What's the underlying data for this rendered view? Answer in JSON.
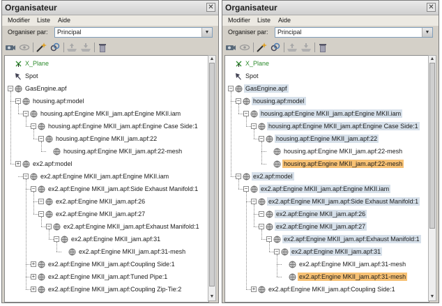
{
  "window": {
    "title": "Organisateur",
    "close_glyph": "✕"
  },
  "menu": [
    "Modifier",
    "Liste",
    "Aide"
  ],
  "organiser": {
    "label": "Organiser par:",
    "value": "Principal"
  },
  "toolbar_icons": [
    "camera-icon",
    "eye-icon",
    "wand-icon",
    "link-icon",
    "tray-in-icon",
    "tray-out-icon",
    "trash-icon"
  ],
  "colors": {
    "row_highlight": "#d6e0ea",
    "selection": "#f7c174",
    "xplane_text": "#2e8b2e"
  },
  "panels": [
    {
      "id": "left",
      "scroll_position": 0.0,
      "scroll_visible_fraction": 0.97,
      "rows": [
        {
          "label": "X_Plane",
          "icon": "xplane-icon",
          "level": 0,
          "exp": "none",
          "style": "green"
        },
        {
          "label": "Spot",
          "icon": "spot-icon",
          "level": 0,
          "exp": "none",
          "style": ""
        },
        {
          "label": "GasEngine.apf",
          "icon": "globe-icon",
          "level": 0,
          "exp": "minus",
          "style": ""
        },
        {
          "label": "housing.apf:model",
          "icon": "globe-icon",
          "level": 1,
          "exp": "minus",
          "style": ""
        },
        {
          "label": "housing.apf:Engine MKII_jam.apf:Engine MKII.iam",
          "icon": "globe-icon",
          "level": 2,
          "exp": "minus",
          "style": ""
        },
        {
          "label": "housing.apf:Engine MKII_jam.apf:Engine Case Side:1",
          "icon": "globe-icon",
          "level": 3,
          "exp": "minus",
          "style": ""
        },
        {
          "label": "housing.apf:Engine MKII_jam.apf:22",
          "icon": "globe-icon",
          "level": 4,
          "exp": "minus",
          "style": ""
        },
        {
          "label": "housing.apf:Engine MKII_jam.apf:22-mesh",
          "icon": "globe-icon",
          "level": 5,
          "exp": "none",
          "style": ""
        },
        {
          "label": "ex2.apf:model",
          "icon": "globe-icon",
          "level": 1,
          "exp": "plus",
          "style": ""
        },
        {
          "label": "ex2.apf:Engine MKII_jam.apf:Engine MKII.iam",
          "icon": "globe-icon",
          "level": 2,
          "exp": "minus",
          "style": ""
        },
        {
          "label": "ex2.apf:Engine MKII_jam.apf:Side Exhaust Manifold:1",
          "icon": "globe-icon",
          "level": 3,
          "exp": "minus",
          "style": ""
        },
        {
          "label": "ex2.apf:Engine MKII_jam.apf:26",
          "icon": "globe-icon",
          "level": 4,
          "exp": "minus",
          "style": ""
        },
        {
          "label": "ex2.apf:Engine MKII_jam.apf:27",
          "icon": "globe-icon",
          "level": 4,
          "exp": "minus",
          "style": ""
        },
        {
          "label": "ex2.apf:Engine MKII_jam.apf:Exhaust Manifold:1",
          "icon": "globe-icon",
          "level": 5,
          "exp": "minus",
          "style": ""
        },
        {
          "label": "ex2.apf:Engine MKII_jam.apf:31",
          "icon": "globe-icon",
          "level": 6,
          "exp": "minus",
          "style": ""
        },
        {
          "label": "ex2.apf:Engine MKII_jam.apf:31-mesh",
          "icon": "globe-icon",
          "level": 7,
          "exp": "none",
          "style": ""
        },
        {
          "label": "ex2.apf:Engine MKII_jam.apf:Coupling Side:1",
          "icon": "globe-icon",
          "level": 3,
          "exp": "plus",
          "style": ""
        },
        {
          "label": "ex2.apf:Engine MKII_jam.apf:Tuned Pipe:1",
          "icon": "globe-icon",
          "level": 3,
          "exp": "plus",
          "style": ""
        },
        {
          "label": "ex2.apf:Engine MKII_jam.apf:Coupling Zip-Tie:2",
          "icon": "globe-icon",
          "level": 3,
          "exp": "plus",
          "style": ""
        }
      ]
    },
    {
      "id": "right",
      "scroll_position": 0.0,
      "scroll_visible_fraction": 0.72,
      "rows": [
        {
          "label": "X_Plane",
          "icon": "xplane-icon",
          "level": 0,
          "exp": "none",
          "style": "green"
        },
        {
          "label": "Spot",
          "icon": "spot-icon",
          "level": 0,
          "exp": "none",
          "style": ""
        },
        {
          "label": "GasEngine.apf",
          "icon": "globe-icon",
          "level": 0,
          "exp": "minus",
          "style": "bg"
        },
        {
          "label": "housing.apf:model",
          "icon": "globe-icon",
          "level": 1,
          "exp": "minus",
          "style": "bg"
        },
        {
          "label": "housing.apf:Engine MKII_jam.apf:Engine MKII.iam",
          "icon": "globe-icon",
          "level": 2,
          "exp": "minus",
          "style": "bg"
        },
        {
          "label": "housing.apf:Engine MKII_jam.apf:Engine Case Side:1",
          "icon": "globe-icon",
          "level": 3,
          "exp": "minus",
          "style": "bg"
        },
        {
          "label": "housing.apf:Engine MKII_jam.apf:22",
          "icon": "globe-icon",
          "level": 4,
          "exp": "minus",
          "style": "bg"
        },
        {
          "label": "housing.apf:Engine MKII_jam.apf:22-mesh",
          "icon": "globe-icon",
          "level": 5,
          "exp": "none",
          "style": ""
        },
        {
          "label": "housing.apf:Engine MKII_jam.apf:22-mesh",
          "icon": "globe-icon",
          "level": 5,
          "exp": "none",
          "style": "sel"
        },
        {
          "label": "ex2.apf:model",
          "icon": "globe-icon",
          "level": 1,
          "exp": "minus",
          "style": "bg"
        },
        {
          "label": "ex2.apf:Engine MKII_jam.apf:Engine MKII.iam",
          "icon": "globe-icon",
          "level": 2,
          "exp": "minus",
          "style": "bg"
        },
        {
          "label": "ex2.apf:Engine MKII_jam.apf:Side Exhaust Manifold:1",
          "icon": "globe-icon",
          "level": 3,
          "exp": "minus",
          "style": "bg"
        },
        {
          "label": "ex2.apf:Engine MKII_jam.apf:26",
          "icon": "globe-icon",
          "level": 4,
          "exp": "minus",
          "style": "bg"
        },
        {
          "label": "ex2.apf:Engine MKII_jam.apf:27",
          "icon": "globe-icon",
          "level": 4,
          "exp": "minus",
          "style": "bg"
        },
        {
          "label": "ex2.apf:Engine MKII_jam.apf:Exhaust Manifold:1",
          "icon": "globe-icon",
          "level": 5,
          "exp": "minus",
          "style": "bg"
        },
        {
          "label": "ex2.apf:Engine MKII_jam.apf:31",
          "icon": "globe-icon",
          "level": 6,
          "exp": "minus",
          "style": "bg"
        },
        {
          "label": "ex2.apf:Engine MKII_jam.apf:31-mesh",
          "icon": "globe-icon",
          "level": 7,
          "exp": "none",
          "style": ""
        },
        {
          "label": "ex2.apf:Engine MKII_jam.apf:31-mesh",
          "icon": "globe-icon",
          "level": 7,
          "exp": "none",
          "style": "sel"
        },
        {
          "label": "ex2.apf:Engine MKII_jam.apf:Coupling Side:1",
          "icon": "globe-icon",
          "level": 3,
          "exp": "plus",
          "style": ""
        }
      ]
    }
  ]
}
